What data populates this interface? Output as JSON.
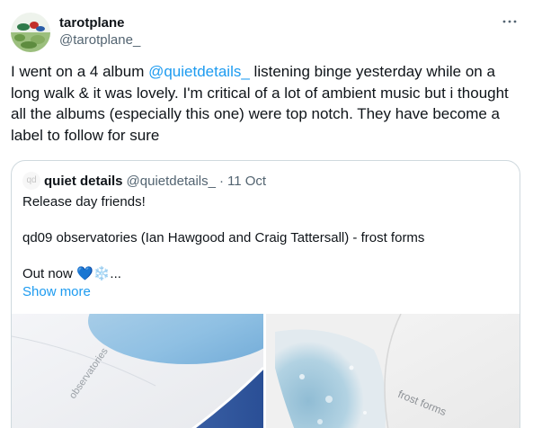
{
  "tweet": {
    "display_name": "tarotplane",
    "handle": "@tarotplane_",
    "more_icon": "ellipsis-icon",
    "text_before": "I went on a 4 album ",
    "mention": "@quietdetails_",
    "text_after": " listening binge yesterday while on a long walk & it was lovely. I'm critical of a lot of ambient music but i thought all the albums (especially this one) were top notch. They have become a label to follow for sure"
  },
  "quote": {
    "avatar_text": "qd",
    "display_name": "quiet details",
    "handle": "@quietdetails_",
    "dot": "·",
    "date": "11 Oct",
    "line1": "Release day friends!",
    "line2": "qd09 observatories (Ian Hawgood and Craig Tattersall) - frost forms",
    "line3_prefix": "Out now ",
    "heart_emoji": "💙",
    "snow_emoji": "❄️",
    "ellipsis": "...",
    "show_more": "Show more"
  },
  "media": {
    "left_label": "observatories",
    "right_label": "frost forms"
  },
  "colors": {
    "text": "#0f1419",
    "secondary": "#536471",
    "link": "#1d9bf0",
    "border": "#cfd9de"
  }
}
